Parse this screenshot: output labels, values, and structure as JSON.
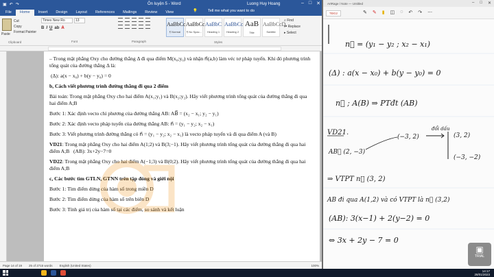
{
  "word": {
    "title_doc": "Ôn luyện 5 - Word",
    "title_user": "Luong Huy Hoang",
    "tabs": [
      "File",
      "Home",
      "Insert",
      "Design",
      "Layout",
      "References",
      "Mailings",
      "Review",
      "View"
    ],
    "tell_me": "Tell me what you want to do",
    "clipboard": {
      "paste": "Paste",
      "cut": "Cut",
      "copy": "Copy",
      "format_painter": "Format Painter",
      "label": "Clipboard"
    },
    "font": {
      "name": "Times New Ro",
      "size": "13",
      "label": "Font"
    },
    "paragraph_label": "Paragraph",
    "styles": [
      {
        "sample": "AaBbCcD",
        "name": "¶ Normal"
      },
      {
        "sample": "AaBbCcD",
        "name": "¶ No Spac..."
      },
      {
        "sample": "AaBbC",
        "name": "Heading 1"
      },
      {
        "sample": "AaBbCc",
        "name": "Heading 2"
      },
      {
        "sample": "AaB",
        "name": "Title"
      },
      {
        "sample": "AaBbCcD",
        "name": "Subtitle"
      }
    ],
    "styles_label": "Styles",
    "editing": {
      "find": "Find",
      "replace": "Replace",
      "select": "Select",
      "label": "Editing"
    },
    "status": {
      "page": "Page 14 of 19",
      "words": "25 of 2715 words",
      "lang": "English (United States)",
      "zoom": "100%"
    },
    "content": {
      "p1": "– Trong mặt phẳng Oxy cho đường thẳng Δ đi qua điểm M(x₀;y₀) và nhận n⃗(a,b) làm véc tơ pháp tuyến. Khi đó phương trình tổng quát của đường thẳng Δ là:",
      "formula1": "(Δ): a(x − x₀) + b(y − y₀) = 0",
      "h1": "b, Cách viết phương trình đường thẳng đi qua 2 điểm",
      "p2": "Bài toán: Trong mặt phẳng Oxy cho hai điểm A(x₁;y₁) và B(x₂;y₂). Hãy viết phương trình tổng quát của đường thẳng đi qua hai điểm A;B",
      "s1": "Bước 1: Xác định vecto chỉ phương của đường thẳng AB: AB⃗ = (x₂ − x₁; y₂ − y₁)",
      "s2": "Bước 2: Xác định vecto pháp tuyến của đường thẳng AB: n⃗ = (y₁ − y₂; x₂ − x₁)",
      "s3": "Bước 3: Viết phương trình đường thẳng có n⃗ = (y₁ − y₂; x₂ − x₁) là vecto pháp tuyến và đi qua điểm A (và B)",
      "vd21_label": "VD21",
      "vd21_text": ": Trong mặt phẳng Oxy cho hai điểm A(1;2) và B(3;−1). Hãy viết phương trình tổng quát của đường thẳng đi qua hai điểm A;B",
      "vd21_answer": "(AB): 3x+2y−7=0",
      "vd22_label": "VD22",
      "vd22_text": ": Trong mặt phẳng Oxy cho hai điểm A(−1;3) và B(0;2). Hãy viết phương trình tổng quát của đường thẳng đi qua hai điểm A;B",
      "h2": "c, Các bước tìm GTLN, GTNN trên tập đóng và giới nội",
      "c1": "Bước 1: Tìm điểm dừng của hàm số trong miền D",
      "c2": "Bước 2: Tìm điểm dừng của hàm số trên biên D",
      "c3": "Bước 3: Tính giá trị của hàm số tại các điểm, so sánh và kết luận"
    },
    "watermark": "ONTHI 360"
  },
  "note": {
    "title": "ArtRage / Note — Untitled",
    "tab": "TĐG2",
    "trial": "TRIAL",
    "lines": {
      "l1": "n⃗ = (y₁ − y₂ ; x₂ − x₁)",
      "l2": "(Δ) : a(x − x₀) + b(y − y₀) = 0",
      "l3": "n⃗ ; A(B) ⇒ PTđt (AB)",
      "vd": "VD21.",
      "ab": "AB⃗ (2, −3)",
      "vec1": "(−3, 2)",
      "vec2": "(3, 2)",
      "vec3": "(−3, −2)",
      "dc": "đổi dấu",
      "vtpt": "⇒ VTPT  n⃗ (3, 2)",
      "abline": "AB đi qua A(1,2) và có VTPT là n⃗ (3,2)",
      "eq1": "(AB): 3(x−1) + 2(y−2) = 0",
      "eq2": "⇔  3x + 2y − 7 = 0"
    }
  },
  "taskbar": {
    "time": "14:17",
    "date": "28/01/2023"
  }
}
